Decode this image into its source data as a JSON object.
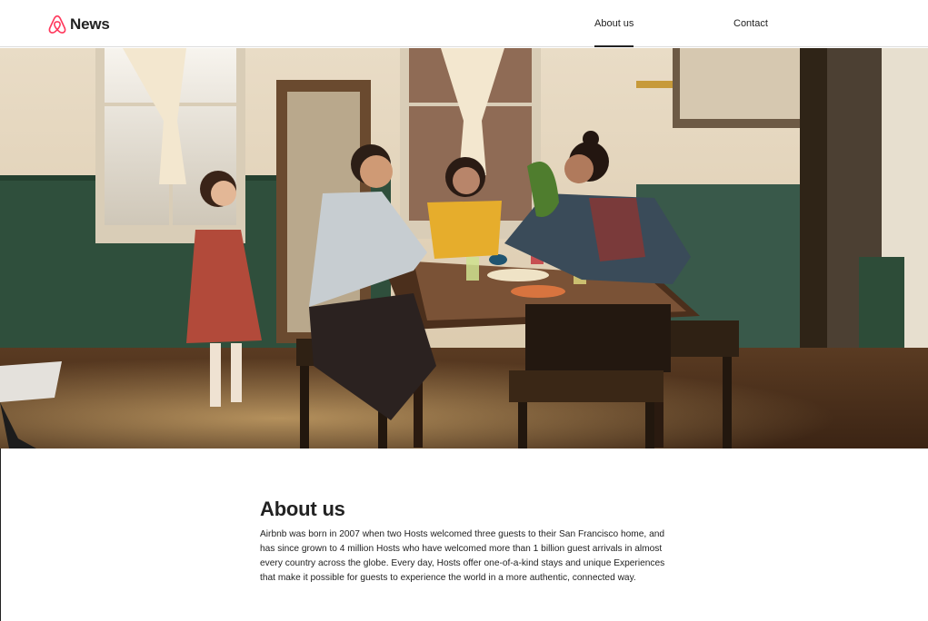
{
  "header": {
    "logo_icon": "airbnb-belo-icon",
    "brand": "News",
    "brand_color": "#FF385C",
    "nav": [
      {
        "label": "About us",
        "active": true
      },
      {
        "label": "Contact",
        "active": false
      }
    ]
  },
  "hero": {
    "image": "family-dinner-photo"
  },
  "about": {
    "title": "About us",
    "body": "Airbnb was born in 2007 when two Hosts welcomed three guests to their San Francisco home, and has since grown to 4 million Hosts who have welcomed more than 1 billion guest arrivals in almost every country across the globe. Every day, Hosts offer one-of-a-kind stays and unique Experiences that make it possible for guests to experience the world in a more authentic, connected way."
  }
}
